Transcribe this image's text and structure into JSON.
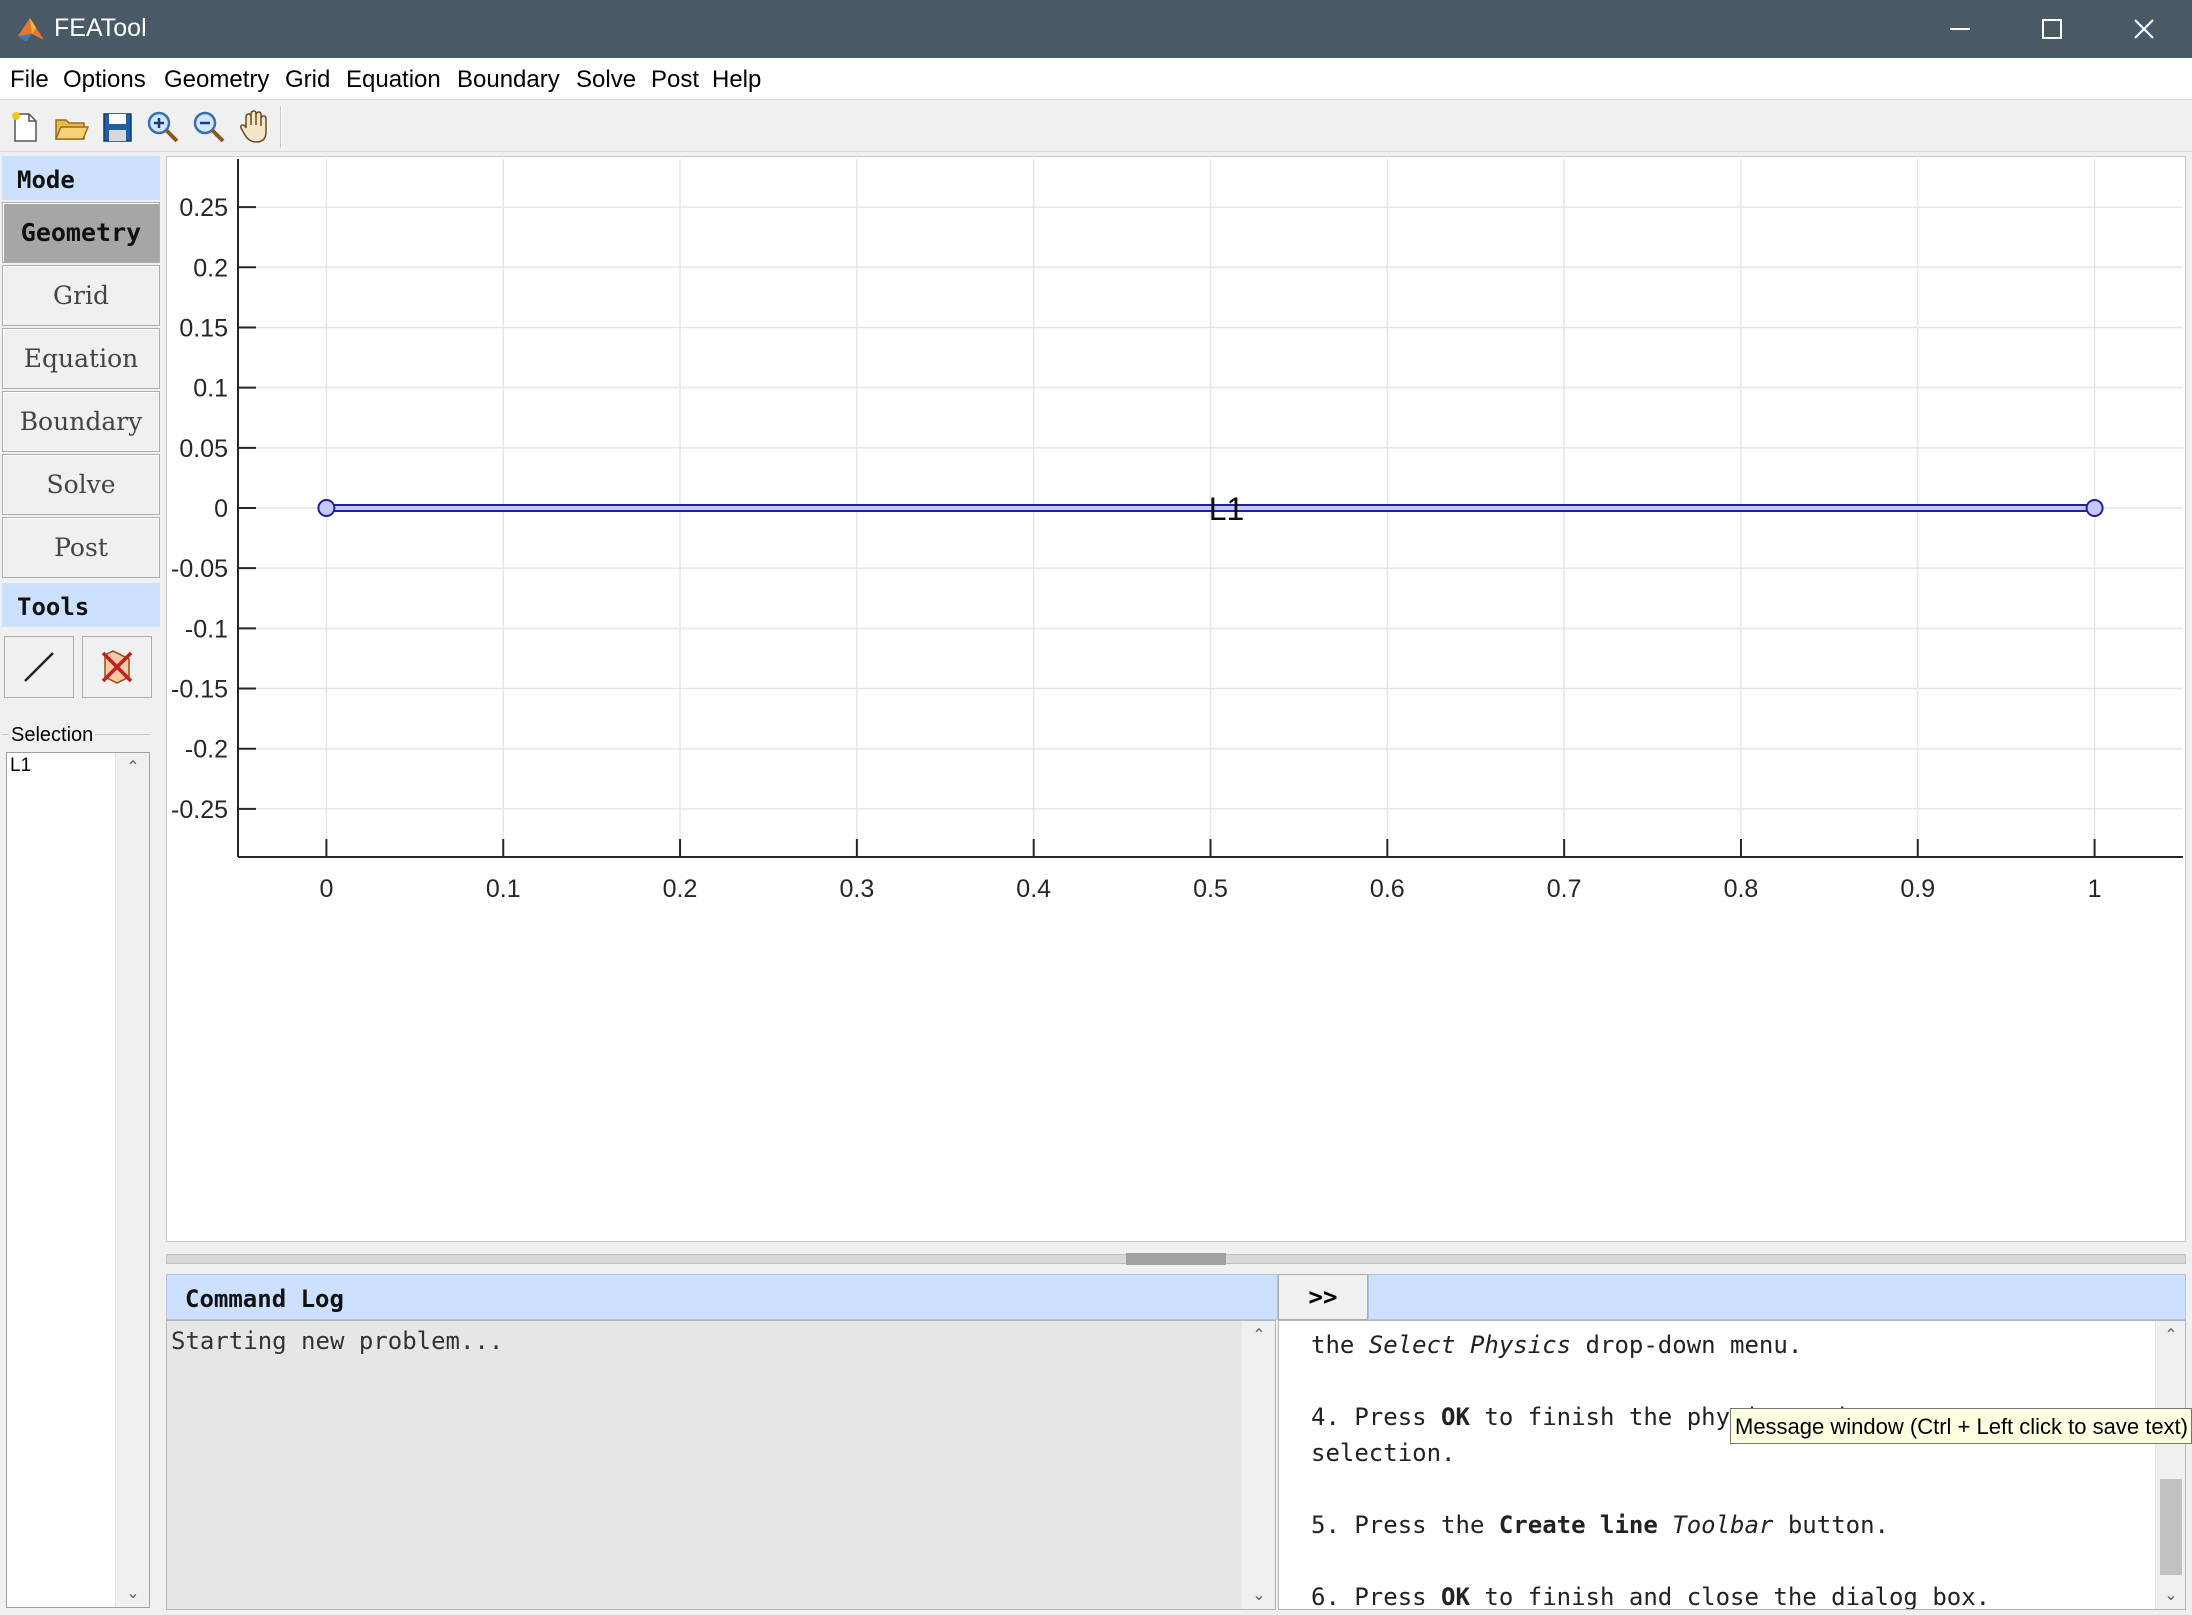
{
  "window": {
    "title": "FEATool"
  },
  "menubar": {
    "items": [
      "File",
      "Options",
      "Geometry",
      "Grid",
      "Equation",
      "Boundary",
      "Solve",
      "Post",
      "Help"
    ]
  },
  "toolbar": {
    "icons": [
      "new-file-icon",
      "open-folder-icon",
      "save-icon",
      "zoom-in-icon",
      "zoom-out-icon",
      "pan-hand-icon"
    ]
  },
  "sidebar": {
    "mode_header": "Mode",
    "modes": [
      "Geometry",
      "Grid",
      "Equation",
      "Boundary",
      "Solve",
      "Post"
    ],
    "active_mode": "Geometry",
    "tools_header": "Tools",
    "tools": [
      "create-line-icon",
      "delete-object-icon"
    ],
    "selection_label": "Selection",
    "selection_items": [
      "L1"
    ]
  },
  "plot": {
    "xticks": [
      "0",
      "0.1",
      "0.2",
      "0.3",
      "0.4",
      "0.5",
      "0.6",
      "0.7",
      "0.8",
      "0.9",
      "1"
    ],
    "yticks": [
      "0.25",
      "0.2",
      "0.15",
      "0.1",
      "0.05",
      "0",
      "-0.05",
      "-0.1",
      "-0.15",
      "-0.2",
      "-0.25"
    ],
    "xlim": [
      -0.05,
      1.05
    ],
    "ylim": [
      -0.29,
      0.29
    ],
    "grid": true,
    "line": {
      "label": "L1",
      "x": [
        0,
        1
      ],
      "y": [
        0,
        0
      ],
      "color": "#2020a0",
      "fill": "#c8c8ff"
    }
  },
  "command_log": {
    "header": "Command Log",
    "text": "Starting new problem...",
    "expand_label": ">>"
  },
  "message": {
    "lines": [
      [
        {
          "t": "the "
        },
        {
          "t": "Select Physics",
          "s": "i"
        },
        {
          "t": " drop-down menu."
        }
      ],
      [],
      [
        {
          "t": "4. Press "
        },
        {
          "t": "OK",
          "s": "b"
        },
        {
          "t": " to finish the physics mode"
        }
      ],
      [
        {
          "t": "selection."
        }
      ],
      [],
      [
        {
          "t": "5. Press the "
        },
        {
          "t": "Create line",
          "s": "b"
        },
        {
          "t": " "
        },
        {
          "t": "Toolbar",
          "s": "i"
        },
        {
          "t": " button."
        }
      ],
      [],
      [
        {
          "t": "6. Press "
        },
        {
          "t": "OK",
          "s": "b"
        },
        {
          "t": " to finish and close the dialog box."
        }
      ]
    ],
    "tooltip": "Message window (Ctrl + Left click to save text)"
  }
}
